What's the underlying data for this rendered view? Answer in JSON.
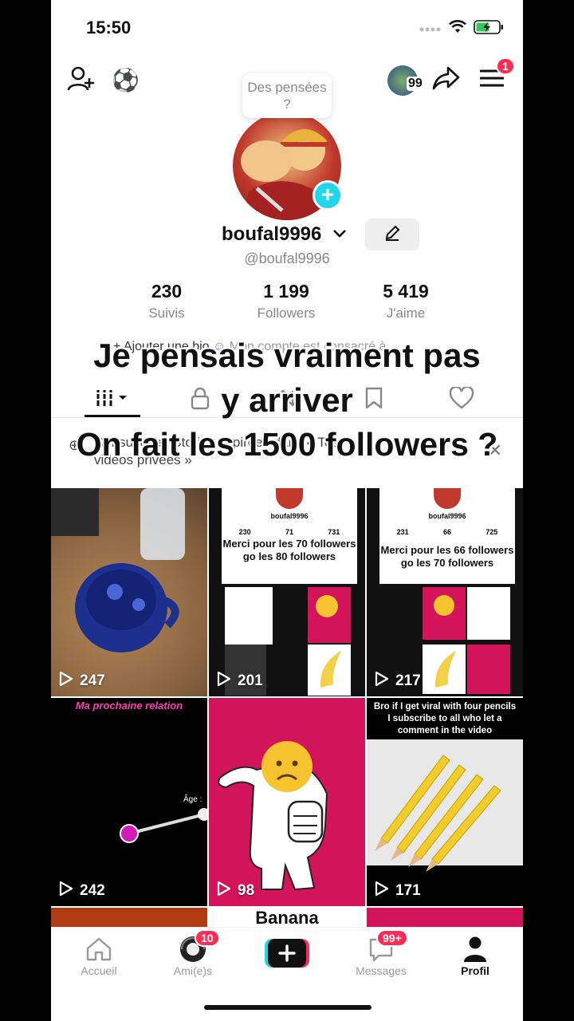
{
  "status_bar": {
    "time": "15:50"
  },
  "topbar": {
    "menu_badge": "1",
    "friend_badge": "99"
  },
  "profile": {
    "thought_bubble": "Des pensées ?",
    "username": "boufal9996",
    "handle": "@boufal9996",
    "stats": [
      {
        "value": "230",
        "label": "Suivis"
      },
      {
        "value": "1 199",
        "label": "Followers"
      },
      {
        "value": "5 419",
        "label": "J'aime"
      }
    ],
    "bio_add": "+ Ajouter une bio",
    "bio_account": "Mon compte est consacré à"
  },
  "stories_notice": "Consulte les Stories expirées dans « Tes vidéos privées »",
  "overlay_caption": {
    "line1": "Je pensais vraiment pas",
    "line2": "y arriver",
    "line3": "On fait les 1500 followers ?"
  },
  "videos": [
    {
      "views": "247"
    },
    {
      "views": "201",
      "caption": "Merci pour les 70 followers go les 80 followers"
    },
    {
      "views": "217",
      "caption": "Merci pour les 66 followers go les 70 followers"
    },
    {
      "views": "242",
      "title": "Ma prochaine relation",
      "label": "Âge :"
    },
    {
      "views": "98"
    },
    {
      "views": "171",
      "title": "Bro if I get viral with four pencils I subscribe to all who let a comment in the video"
    }
  ],
  "partial_row": {
    "middle_text": "Banana"
  },
  "mini_profiles": [
    {
      "name": "boufal9996",
      "stats": [
        "230",
        "71",
        "731"
      ]
    },
    {
      "name": "boufal9996",
      "stats": [
        "231",
        "66",
        "725"
      ]
    }
  ],
  "bottom_nav": {
    "home": "Accueil",
    "friends": "Ami(e)s",
    "friends_badge": "10",
    "messages": "Messages",
    "messages_badge": "99+",
    "profile": "Profil"
  },
  "colors": {
    "accent": "#fe2c55",
    "cyan": "#20d5ec"
  }
}
